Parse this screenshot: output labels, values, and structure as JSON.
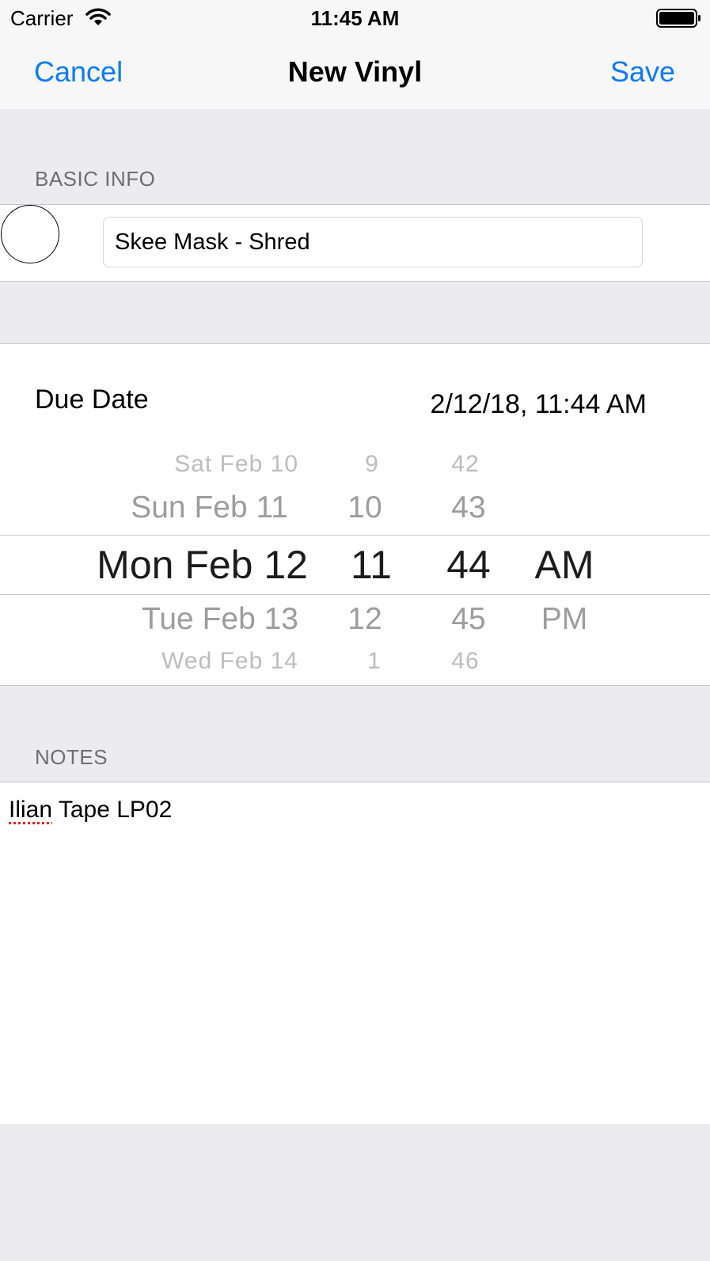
{
  "status_bar": {
    "carrier": "Carrier",
    "time": "11:45 AM",
    "wifi_icon": "wifi-icon",
    "battery_icon": "battery-icon"
  },
  "nav": {
    "cancel_label": "Cancel",
    "title": "New Vinyl",
    "save_label": "Save"
  },
  "basic_info": {
    "header": "BASIC INFO",
    "title_value": "Skee Mask - Shred"
  },
  "due_date": {
    "label": "Due Date",
    "value": "2/12/18, 11:44 AM",
    "picker": {
      "days": [
        "Sat Feb 10",
        "Sun Feb 11",
        "Mon Feb 12",
        "Tue Feb 13",
        "Wed Feb 14"
      ],
      "hours": [
        "9",
        "10",
        "11",
        "12",
        "1"
      ],
      "minutes": [
        "42",
        "43",
        "44",
        "45",
        "46"
      ],
      "ampm": [
        "AM",
        "PM"
      ],
      "selected": {
        "day": "Mon Feb 12",
        "hour": "11",
        "minute": "44",
        "ampm": "AM"
      }
    }
  },
  "notes": {
    "header": "NOTES",
    "text_word1": "Ilian",
    "text_rest": " Tape LP02"
  },
  "colors": {
    "accent": "#0a7aff",
    "grouped_background": "#ebebf0",
    "separator": "#c8c7cc",
    "section_header": "#6d6d72",
    "spellcheck": "#e02424"
  }
}
